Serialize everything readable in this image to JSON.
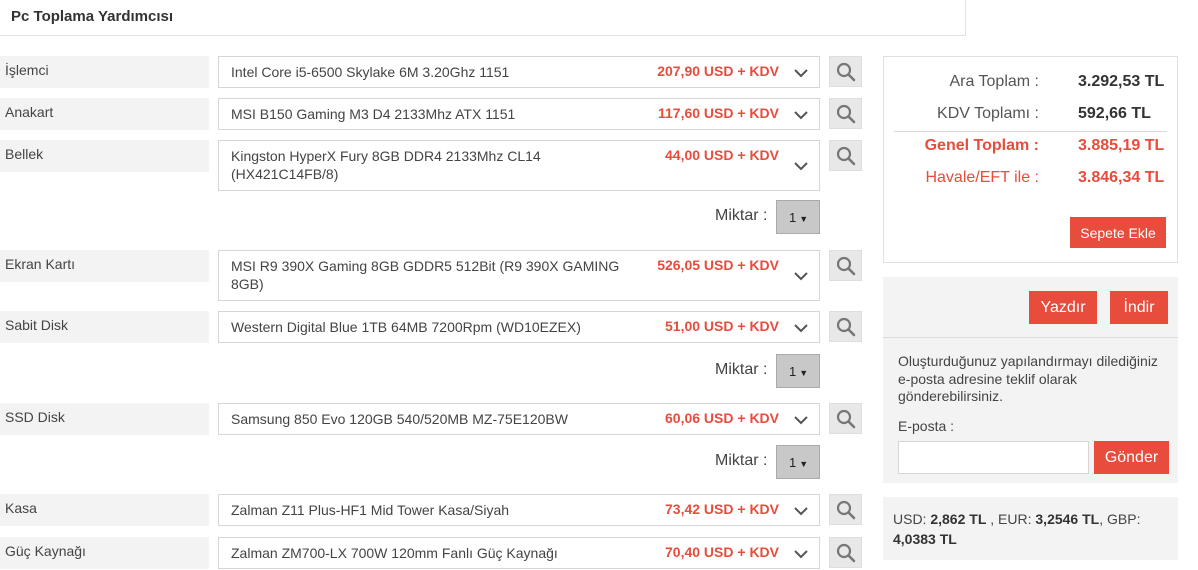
{
  "page": {
    "title": "Pc Toplama Yardımcısı"
  },
  "components": [
    {
      "label": "İşlemci",
      "product": "Intel Core i5-6500 Skylake 6M 3.20Ghz 1151",
      "price": "207,90 USD + KDV"
    },
    {
      "label": "Anakart",
      "product": "MSI B150 Gaming M3 D4 2133Mhz ATX 1151",
      "price": "117,60 USD + KDV"
    },
    {
      "label": "Bellek",
      "product": "Kingston HyperX Fury 8GB DDR4 2133Mhz CL14 (HX421C14FB/8)",
      "price": "44,00 USD + KDV",
      "quantity": "1"
    },
    {
      "label": "Ekran Kartı",
      "product": "MSI R9 390X Gaming 8GB GDDR5 512Bit (R9 390X GAMING 8GB)",
      "price": "526,05 USD + KDV"
    },
    {
      "label": "Sabit Disk",
      "product": "Western Digital Blue 1TB 64MB 7200Rpm (WD10EZEX)",
      "price": "51,00 USD + KDV",
      "quantity": "1"
    },
    {
      "label": "SSD Disk",
      "product": "Samsung 850 Evo 120GB 540/520MB MZ-75E120BW",
      "price": "60,06 USD + KDV",
      "quantity": "1"
    },
    {
      "label": "Kasa",
      "product": "Zalman Z11 Plus-HF1 Mid Tower Kasa/Siyah",
      "price": "73,42 USD + KDV"
    },
    {
      "label": "Güç Kaynağı",
      "product": "Zalman ZM700-LX 700W 120mm Fanlı Güç Kaynağı",
      "price": "70,40 USD + KDV"
    }
  ],
  "quantity_label": "Miktar :",
  "summary": {
    "subtotal_label": "Ara Toplam :",
    "subtotal_value": "3.292,53 TL",
    "vat_label": "KDV Toplamı :",
    "vat_value": "592,66 TL",
    "total_label": "Genel Toplam :",
    "total_value": "3.885,19 TL",
    "transfer_label": "Havale/EFT ile :",
    "transfer_value": "3.846,34 TL",
    "add_to_cart": "Sepete Ekle"
  },
  "actions": {
    "print": "Yazdır",
    "download": "İndir",
    "message": "Oluşturduğunuz yapılandırmayı dilediğiniz e-posta adresine teklif olarak gönderebilirsiniz.",
    "email_label": "E-posta :",
    "email_value": "",
    "send": "Gönder"
  },
  "rates": {
    "usd_label": "USD:",
    "usd_value": "2,862 TL",
    "eur_label": ", EUR:",
    "eur_value": "3,2546 TL",
    "gbp_label": ", GBP:",
    "gbp_value": "4,0383 TL"
  },
  "colors": {
    "accent": "#e74c3c",
    "panel_bg": "#f3f3f3"
  },
  "icons": {
    "search": "magnifier-icon",
    "dropdown": "chevron-down-icon"
  }
}
